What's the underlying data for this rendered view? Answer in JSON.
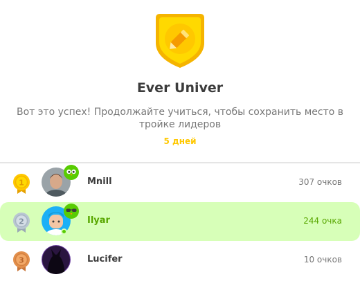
{
  "league": {
    "title": "Ever Univer",
    "subtitle": "Вот это успех! Продолжайте учиться, чтобы сохранить место в тройке лидеров",
    "days_left": "5 дней",
    "badge_icon": "pencil-shield-icon",
    "badge_color": "#ffc800"
  },
  "leaderboard": [
    {
      "rank": "1",
      "name": "Mnill",
      "points": "307 очков",
      "medal_color": "#ffc800",
      "avatar": "photo-avatar",
      "highlighted": false
    },
    {
      "rank": "2",
      "name": "Ilyar",
      "points": "244 очка",
      "medal_color": "#b9c6d2",
      "avatar": "cartoon-avatar",
      "highlighted": true
    },
    {
      "rank": "3",
      "name": "Lucifer",
      "points": "10 очков",
      "medal_color": "#e28f4c",
      "avatar": "dark-avatar",
      "highlighted": false
    }
  ],
  "colors": {
    "accent": "#58cc02",
    "highlight_bg": "#d7ffb8",
    "days_text": "#ffc800"
  }
}
